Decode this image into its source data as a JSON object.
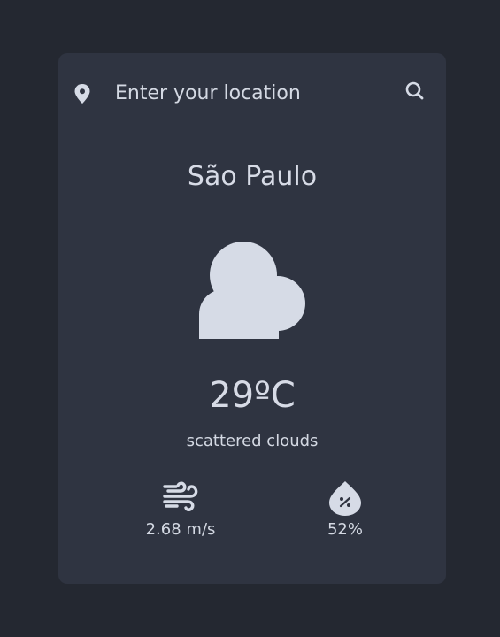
{
  "search": {
    "placeholder": "Enter your location",
    "value": ""
  },
  "weather": {
    "city": "São Paulo",
    "temperature": "29ºC",
    "description": "scattered clouds",
    "condition_icon": "cloud-icon"
  },
  "stats": {
    "wind": {
      "icon": "wind-icon",
      "value": "2.68 m/s"
    },
    "humidity": {
      "icon": "humidity-drop-icon",
      "value": "52%"
    }
  },
  "colors": {
    "page_background": "#242831",
    "card_background": "#2f3441",
    "text": "#d7dbe6",
    "icon": "#d6dbe6"
  }
}
